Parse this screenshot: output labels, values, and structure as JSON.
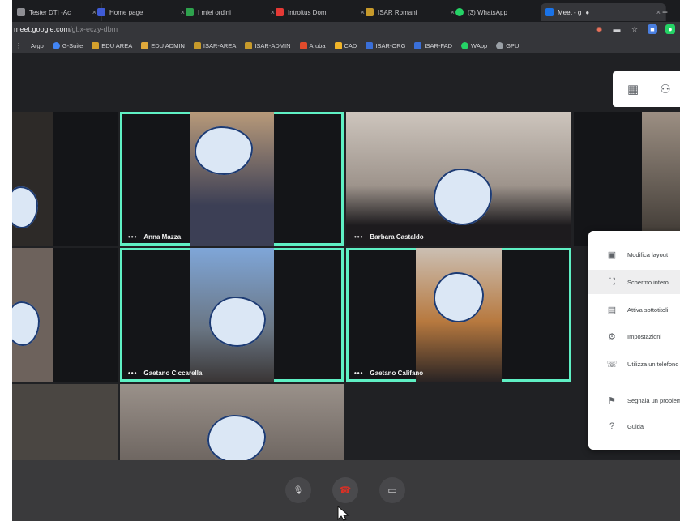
{
  "browser": {
    "tabs": [
      {
        "title": "Tester DTI -Ac",
        "color": "#8e8e93",
        "active": false
      },
      {
        "title": "Home page",
        "color": "#3f5bd6",
        "active": false
      },
      {
        "title": "I miei ordini",
        "color": "#2ea24d",
        "active": false
      },
      {
        "title": "Introitus Dom",
        "color": "#e53935",
        "active": false
      },
      {
        "title": "ISAR Romani",
        "color": "#c79a2b",
        "active": false
      },
      {
        "title": "(3) WhatsApp",
        "color": "#25d366",
        "active": false
      },
      {
        "title": "Meet - g",
        "color": "#1a73e8",
        "active": true
      }
    ],
    "new_tab_glyph": "+",
    "close_glyph": "×",
    "url_host": "meet.google.com",
    "url_path": "/gbx-eczy-dbm",
    "bookmarks": [
      {
        "label": "Argo",
        "color": "#7f8ea3"
      },
      {
        "label": "G-Suite",
        "color": "#4285f4"
      },
      {
        "label": "EDU AREA",
        "color": "#d4a02c"
      },
      {
        "label": "EDU ADMIN",
        "color": "#e0a93b"
      },
      {
        "label": "ISAR-AREA",
        "color": "#c79a2b"
      },
      {
        "label": "ISAR-ADMIN",
        "color": "#c79a2b"
      },
      {
        "label": "Aruba",
        "color": "#e14b2c"
      },
      {
        "label": "CAD",
        "color": "#f0b429"
      },
      {
        "label": "ISAR-ORG",
        "color": "#3a6fd8"
      },
      {
        "label": "ISAR-FAD",
        "color": "#3a6fd8"
      },
      {
        "label": "WApp",
        "color": "#25d366"
      },
      {
        "label": "GPU",
        "color": "#9aa0a6"
      }
    ]
  },
  "participants": [
    {
      "name": "Anna Mazza"
    },
    {
      "name": "Barbara Castaldo"
    },
    {
      "name": "Gaetano Ciccarella"
    },
    {
      "name": "Gaetano Califano"
    }
  ],
  "name_dots": "•••",
  "menu": {
    "items": [
      {
        "label": "Modifica layout",
        "icon": "layout-icon",
        "glyph": "▣"
      },
      {
        "label": "Schermo intero",
        "icon": "fullscreen-icon",
        "glyph": "⛶"
      },
      {
        "label": "Attiva sottotitoli",
        "icon": "captions-icon",
        "glyph": "▤"
      },
      {
        "label": "Impostazioni",
        "icon": "settings-icon",
        "glyph": "⚙"
      },
      {
        "label": "Utilizza un telefono",
        "icon": "phone-icon",
        "glyph": "☏"
      },
      {
        "label": "Segnala un problema",
        "icon": "report-icon",
        "glyph": "⚑"
      },
      {
        "label": "Guida",
        "icon": "help-icon",
        "glyph": "?"
      }
    ]
  },
  "controls": {
    "mic_glyph": "🎙",
    "hangup_glyph": "☎",
    "camera_glyph": "▭"
  },
  "colors": {
    "highlight": "#5ff0c4",
    "hangup": "#d93025"
  }
}
